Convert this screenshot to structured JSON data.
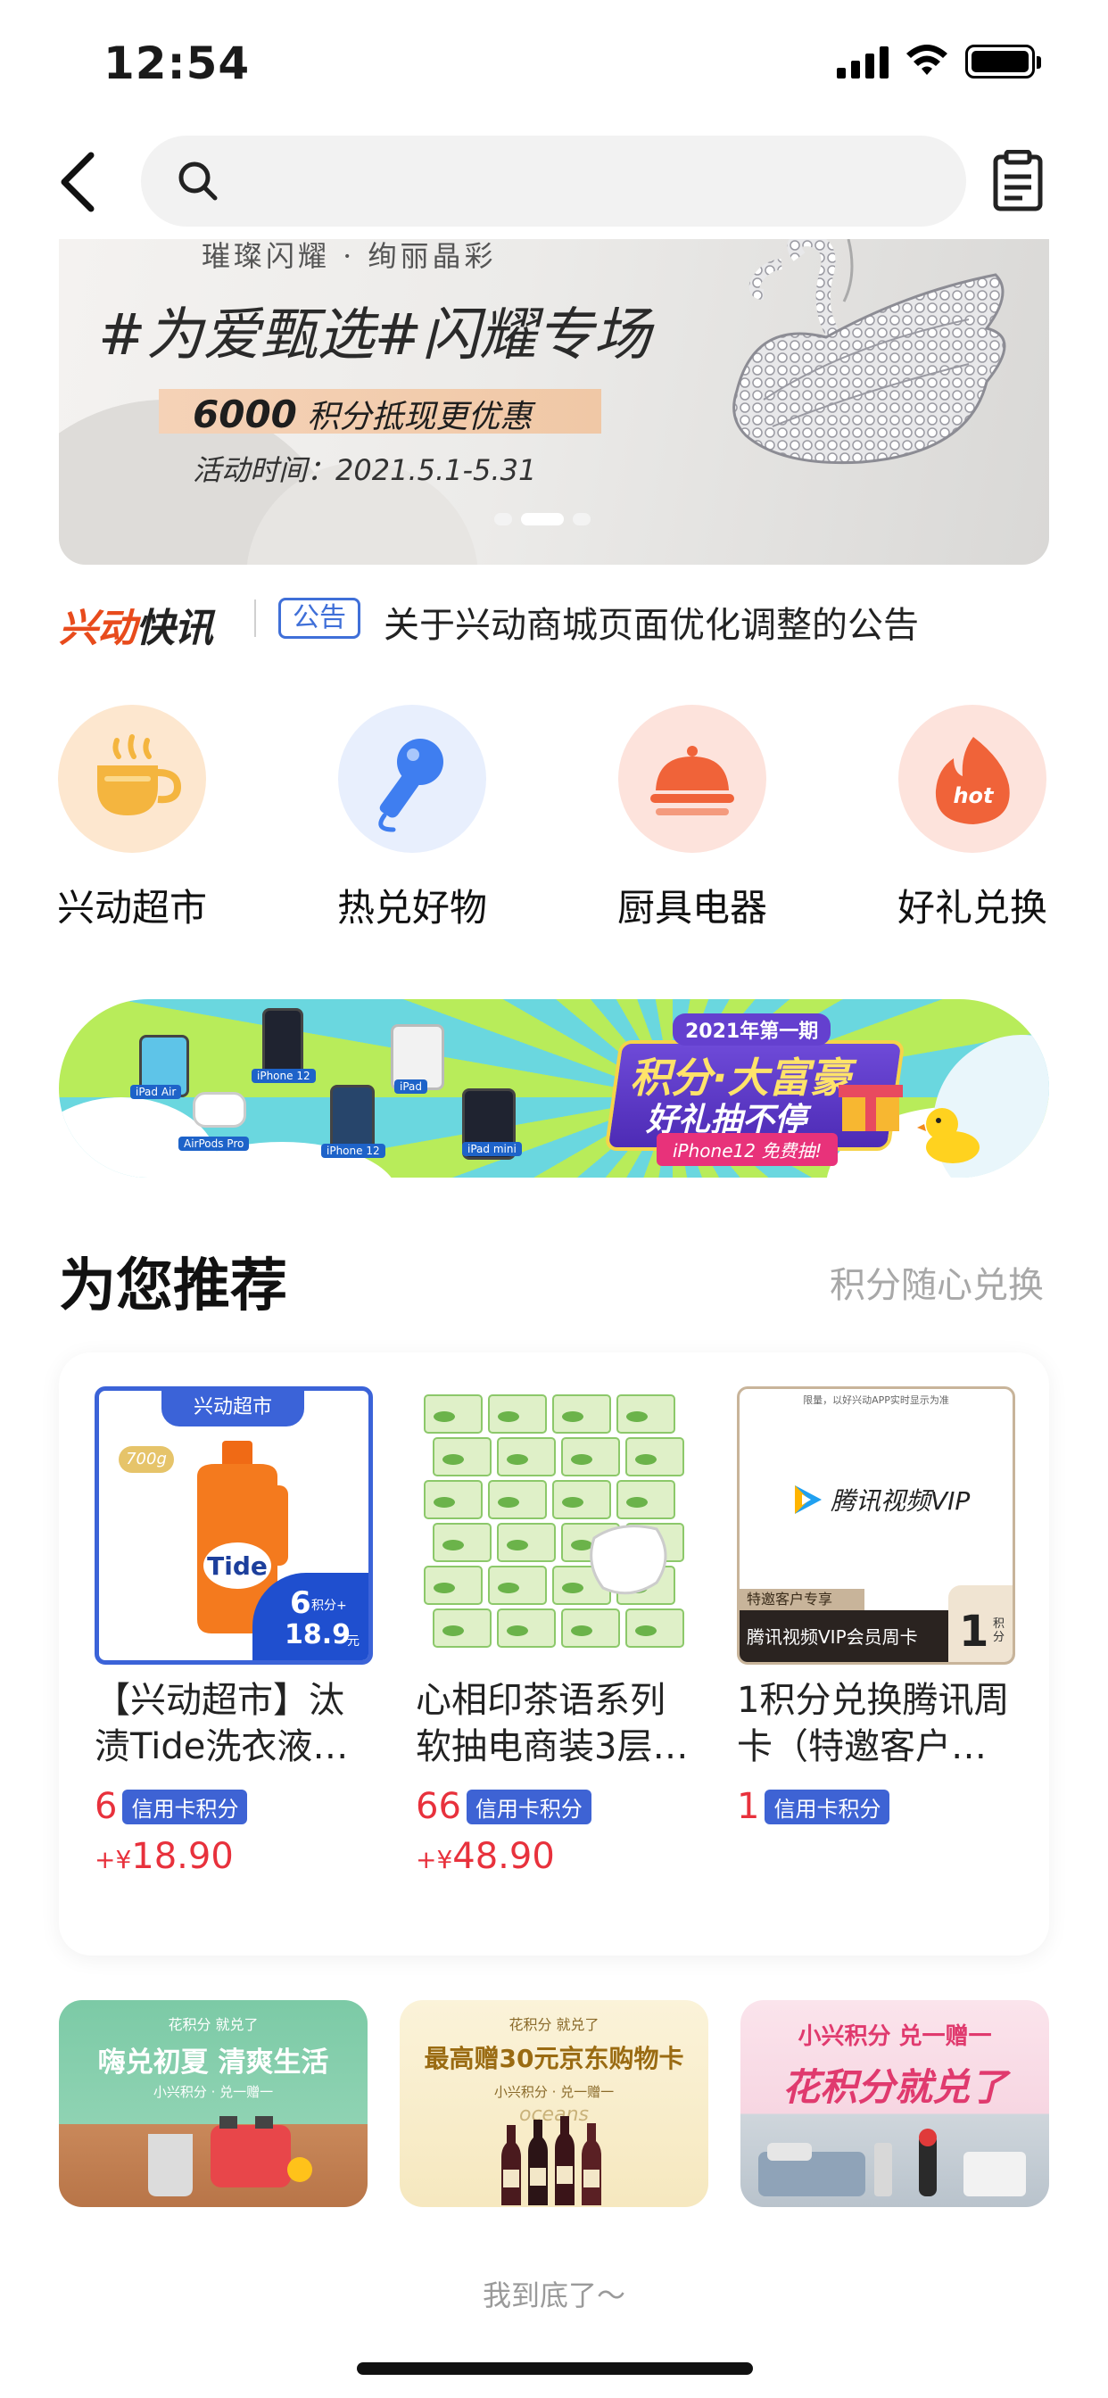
{
  "status_bar": {
    "time": "12:54"
  },
  "search": {
    "placeholder": ""
  },
  "hero": {
    "top_text": "璀璨闪耀 · 绚丽晶彩",
    "title": "#为爱甄选#闪耀专场",
    "points": "6000",
    "points_text": "积分抵现更优惠",
    "date": "活动时间：2021.5.1-5.31"
  },
  "news": {
    "logo_a": "兴动",
    "logo_b": "快讯",
    "badge": "公告",
    "text": "关于兴动商城页面优化调整的公告"
  },
  "categories": [
    {
      "label": "兴动超市",
      "icon": "coffee-cup-icon"
    },
    {
      "label": "热兑好物",
      "icon": "microphone-icon"
    },
    {
      "label": "厨具电器",
      "icon": "cloche-icon"
    },
    {
      "label": "好礼兑换",
      "icon": "hot-flame-icon"
    }
  ],
  "promo": {
    "year": "2021年第一期",
    "title": "积分·大富豪",
    "subtitle": "好礼抽不停",
    "ribbon": "iPhone12 免费抽!",
    "device_labels": [
      "iPad Air",
      "iPhone 12",
      "iPad",
      "AirPods Pro",
      "iPhone 12",
      "iPad mini"
    ]
  },
  "recommend": {
    "title": "为您推荐",
    "more": "积分随心兑换",
    "products": [
      {
        "name": "【兴动超市】汰渍Tide洗衣液…",
        "points": "6",
        "tag": "信用卡积分",
        "price_prefix": "+¥",
        "price": "18.90",
        "img_banner": "兴动超市",
        "img_weight": "700g",
        "img_badge_pts": "6",
        "img_badge_pts_unit": "积分+",
        "img_badge_price": "18.9",
        "img_badge_price_unit": "元"
      },
      {
        "name": "心相印茶语系列软抽电商装3层…",
        "points": "66",
        "tag": "信用卡积分",
        "price_prefix": "+¥",
        "price": "48.90"
      },
      {
        "name": "1积分兑换腾讯周卡（特邀客户…",
        "points": "1",
        "tag": "信用卡积分",
        "img_top": "限量，以好兴动APP实时显示为准",
        "img_brand": "腾讯视频VIP",
        "img_exclusive": "特邀客户专享",
        "img_bottom": "腾讯视频VIP会员周卡",
        "img_pts": "1",
        "img_pts_unit": "积分"
      }
    ]
  },
  "bottom_banners": [
    {
      "t1": "花积分 就兑了",
      "t2": "嗨兑初夏 清爽生活",
      "t3": "小兴积分 · 兑一赠一"
    },
    {
      "t1": "花积分 就兑了",
      "t2": "最高赠30元京东购物卡",
      "t3": "小兴积分 · 兑一赠一",
      "brand": "oceans"
    },
    {
      "t1": "小兴积分 兑一赠一",
      "t2": "花积分就兑了"
    }
  ],
  "footer": {
    "end_text": "我到底了～"
  },
  "colors": {
    "accent_red": "#e8313c",
    "tag_blue": "#3e63d4",
    "news_orange": "#e84b1c"
  }
}
